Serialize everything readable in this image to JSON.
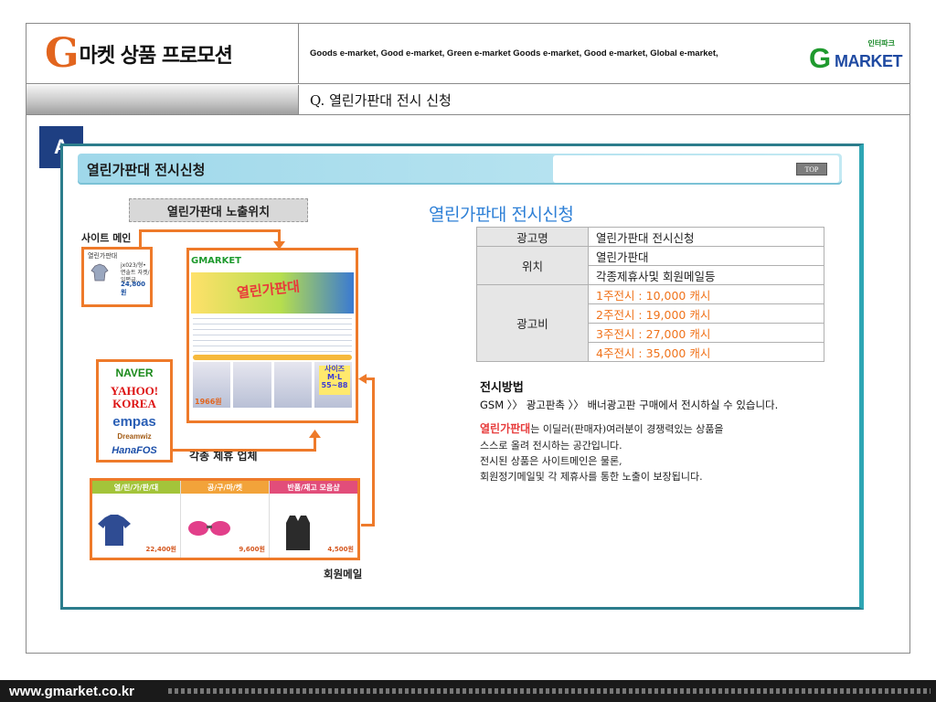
{
  "header": {
    "logo_letter": "G",
    "title": "마켓 상품 프로모션",
    "tagline": "Goods e-market, Good e-market, Green e-market Goods e-market, Good e-market, Global e-market,",
    "gmarket_logo": {
      "badge": "인터파크",
      "g": "G",
      "text": "MARKET"
    }
  },
  "subheader": {
    "question": "Q. 열린가판대 전시 신청"
  },
  "badge": "A",
  "panel": {
    "title": "열린가판대 전시신청",
    "top_button": "TOP",
    "placement_tab": "열린가판대 노출위치",
    "labels": {
      "site_main": "사이트 메인",
      "affiliates": "각종 제휴 업체",
      "member_mail": "회원메일"
    },
    "site_small": {
      "caption": "열린가판대",
      "desc": "jx023/형•면솔트 자켓/일편글...",
      "price": "24,800원"
    },
    "screenshot": {
      "logo": "GMARKET",
      "hero_text": "열린가판대",
      "size_badge": "사이즈 M·L 55~88",
      "side_text": "1966원"
    },
    "portals": [
      "NAVER",
      "YAHOO! KOREA",
      "empas",
      "Dreamwiz",
      "HanaFOS"
    ],
    "mail_strip": [
      {
        "header": "열/린/가/판/대",
        "color": "#a3c43a",
        "price": "22,400원"
      },
      {
        "header": "공/구/마/켓",
        "color": "#f2a33a",
        "price": "9,600원"
      },
      {
        "header": "반품/재고 모음샵",
        "color": "#e24d7a",
        "price": "4,500원"
      }
    ],
    "right_title": "열린가판대 전시신청",
    "table": {
      "rows": [
        {
          "header": "광고명",
          "values": [
            "열린가판대 전시신청"
          ]
        },
        {
          "header": "위치",
          "values": [
            "열린가판대",
            "각종제휴사및 회원메일등"
          ]
        },
        {
          "header": "광고비",
          "values": [
            "1주전시 : 10,000 캐시",
            "2주전시 : 19,000 캐시",
            "3주전시 : 27,000 캐시",
            "4주전시 : 35,000 캐시"
          ]
        }
      ]
    },
    "method": {
      "title": "전시방법",
      "line": "GSM 〉〉 광고판촉 〉〉 배너광고판 구매에서 전시하실 수 있습니다."
    },
    "description": {
      "highlight": "열린가판대",
      "line1_rest": "는 이딜러(판매자)여러분이 경쟁력있는 상품을",
      "line2": "스스로 올려 전시하는 공간입니다.",
      "line3": "전시된 상품은 사이트메인은 물론,",
      "line4": "회원정기메일및 각 제휴사를 통한 노출이 보장됩니다."
    }
  },
  "footer": {
    "url": "www.gmarket.co.kr"
  }
}
